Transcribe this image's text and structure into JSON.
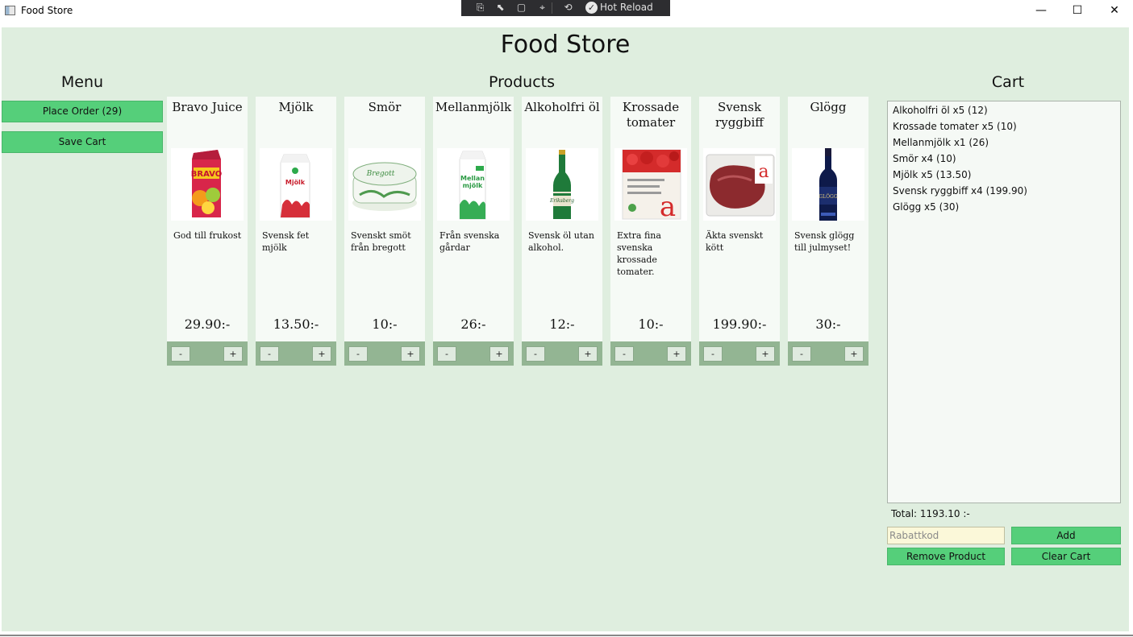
{
  "window": {
    "title": "Food Store",
    "hot_reload_label": "Hot Reload",
    "controls": {
      "minimize": "—",
      "maximize": "☐",
      "close": "✕"
    }
  },
  "app": {
    "title": "Food Store",
    "menu_heading": "Menu",
    "products_heading": "Products",
    "cart_heading": "Cart"
  },
  "menu": {
    "place_order_label": "Place Order (29)",
    "save_cart_label": "Save Cart"
  },
  "products": [
    {
      "name": "Bravo Juice",
      "description": "God till frukost",
      "price": "29.90:-",
      "image": "juice-carton-image",
      "minus": "-",
      "plus": "+"
    },
    {
      "name": "Mjölk",
      "description": "Svensk fet mjölk",
      "price": "13.50:-",
      "image": "milk-carton-image",
      "minus": "-",
      "plus": "+"
    },
    {
      "name": "Smör",
      "description": "Svenskt smöt från bregott",
      "price": "10:-",
      "image": "butter-tub-image",
      "minus": "-",
      "plus": "+"
    },
    {
      "name": "Mellanmjölk",
      "description": "Från svenska gårdar",
      "price": "26:-",
      "image": "milk-carton-green-image",
      "minus": "-",
      "plus": "+"
    },
    {
      "name": "Alkoholfri öl",
      "description": "Svensk öl utan alkohol.",
      "price": "12:-",
      "image": "beer-bottle-image",
      "minus": "-",
      "plus": "+"
    },
    {
      "name": "Krossade tomater",
      "description": "Extra fina svenska krossade tomater.",
      "price": "10:-",
      "image": "tomato-carton-image",
      "minus": "-",
      "plus": "+"
    },
    {
      "name": "Svensk ryggbiff",
      "description": "Äkta svenskt kött",
      "price": "199.90:-",
      "image": "beef-package-image",
      "minus": "-",
      "plus": "+"
    },
    {
      "name": "Glögg",
      "description": "Svensk glögg till julmyset!",
      "price": "30:-",
      "image": "wine-bottle-image",
      "minus": "-",
      "plus": "+"
    }
  ],
  "cart": {
    "items": [
      "Alkoholfri öl x5 (12)",
      "Krossade tomater x5 (10)",
      "Mellanmjölk x1 (26)",
      "Smör x4 (10)",
      "Mjölk x5 (13.50)",
      "Svensk ryggbiff x4 (199.90)",
      "Glögg x5 (30)"
    ],
    "total": "Total: 1193.10 :-",
    "discount_placeholder": "Rabattkod",
    "discount_value": "",
    "add_label": "Add",
    "remove_label": "Remove Product",
    "clear_label": "Clear Cart"
  },
  "colors": {
    "background": "#dfeedf",
    "button_green": "#55cf7a",
    "card_footer": "#93b593",
    "discount_field": "#fbf8d9"
  }
}
